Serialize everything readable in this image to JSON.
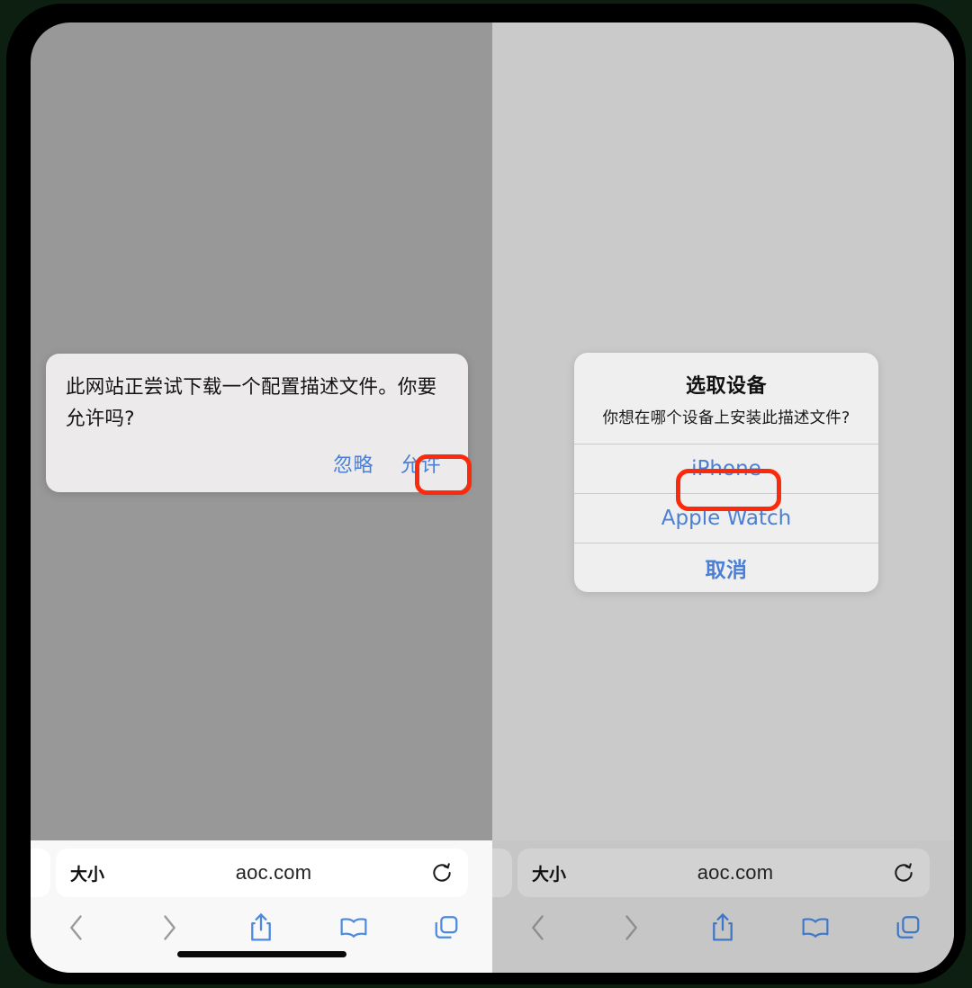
{
  "screen": {
    "left_panel": {
      "background_color": "#989898",
      "alert": {
        "name": "download-profile-alert",
        "message": "此网站正尝试下载一个配置描述文件。你要允许吗?",
        "actions": [
          {
            "label": "忽略",
            "highlighted": false
          },
          {
            "label": "允许",
            "highlighted": true
          }
        ],
        "highlight_color": "#fb2a0c"
      },
      "browser": {
        "url_bar": {
          "left_label": "大小",
          "domain": "aoc.com",
          "reload_icon": "reload-icon"
        },
        "toolbar_icons": [
          "back-icon",
          "forward-icon",
          "share-icon",
          "bookmarks-icon",
          "tabs-icon"
        ]
      }
    },
    "right_panel": {
      "background_color": "#cacaca",
      "alert": {
        "name": "choose-device-alert",
        "title": "选取设备",
        "subtitle": "你想在哪个设备上安装此描述文件?",
        "options": [
          {
            "label": "iPhone",
            "highlighted": true,
            "bold": false
          },
          {
            "label": "Apple Watch",
            "highlighted": false,
            "bold": false
          },
          {
            "label": "取消",
            "highlighted": false,
            "bold": true
          }
        ],
        "highlight_color": "#fb2a0c"
      },
      "browser": {
        "url_bar": {
          "left_label": "大小",
          "domain": "aoc.com",
          "reload_icon": "reload-icon"
        },
        "toolbar_icons": [
          "back-icon",
          "forward-icon",
          "share-icon",
          "bookmarks-icon",
          "tabs-icon"
        ]
      }
    }
  },
  "colors": {
    "accent_blue": "#4b7fd4",
    "highlight_red": "#fb2a0c",
    "frame_black": "#000000",
    "page_background": "#0d1f11"
  }
}
